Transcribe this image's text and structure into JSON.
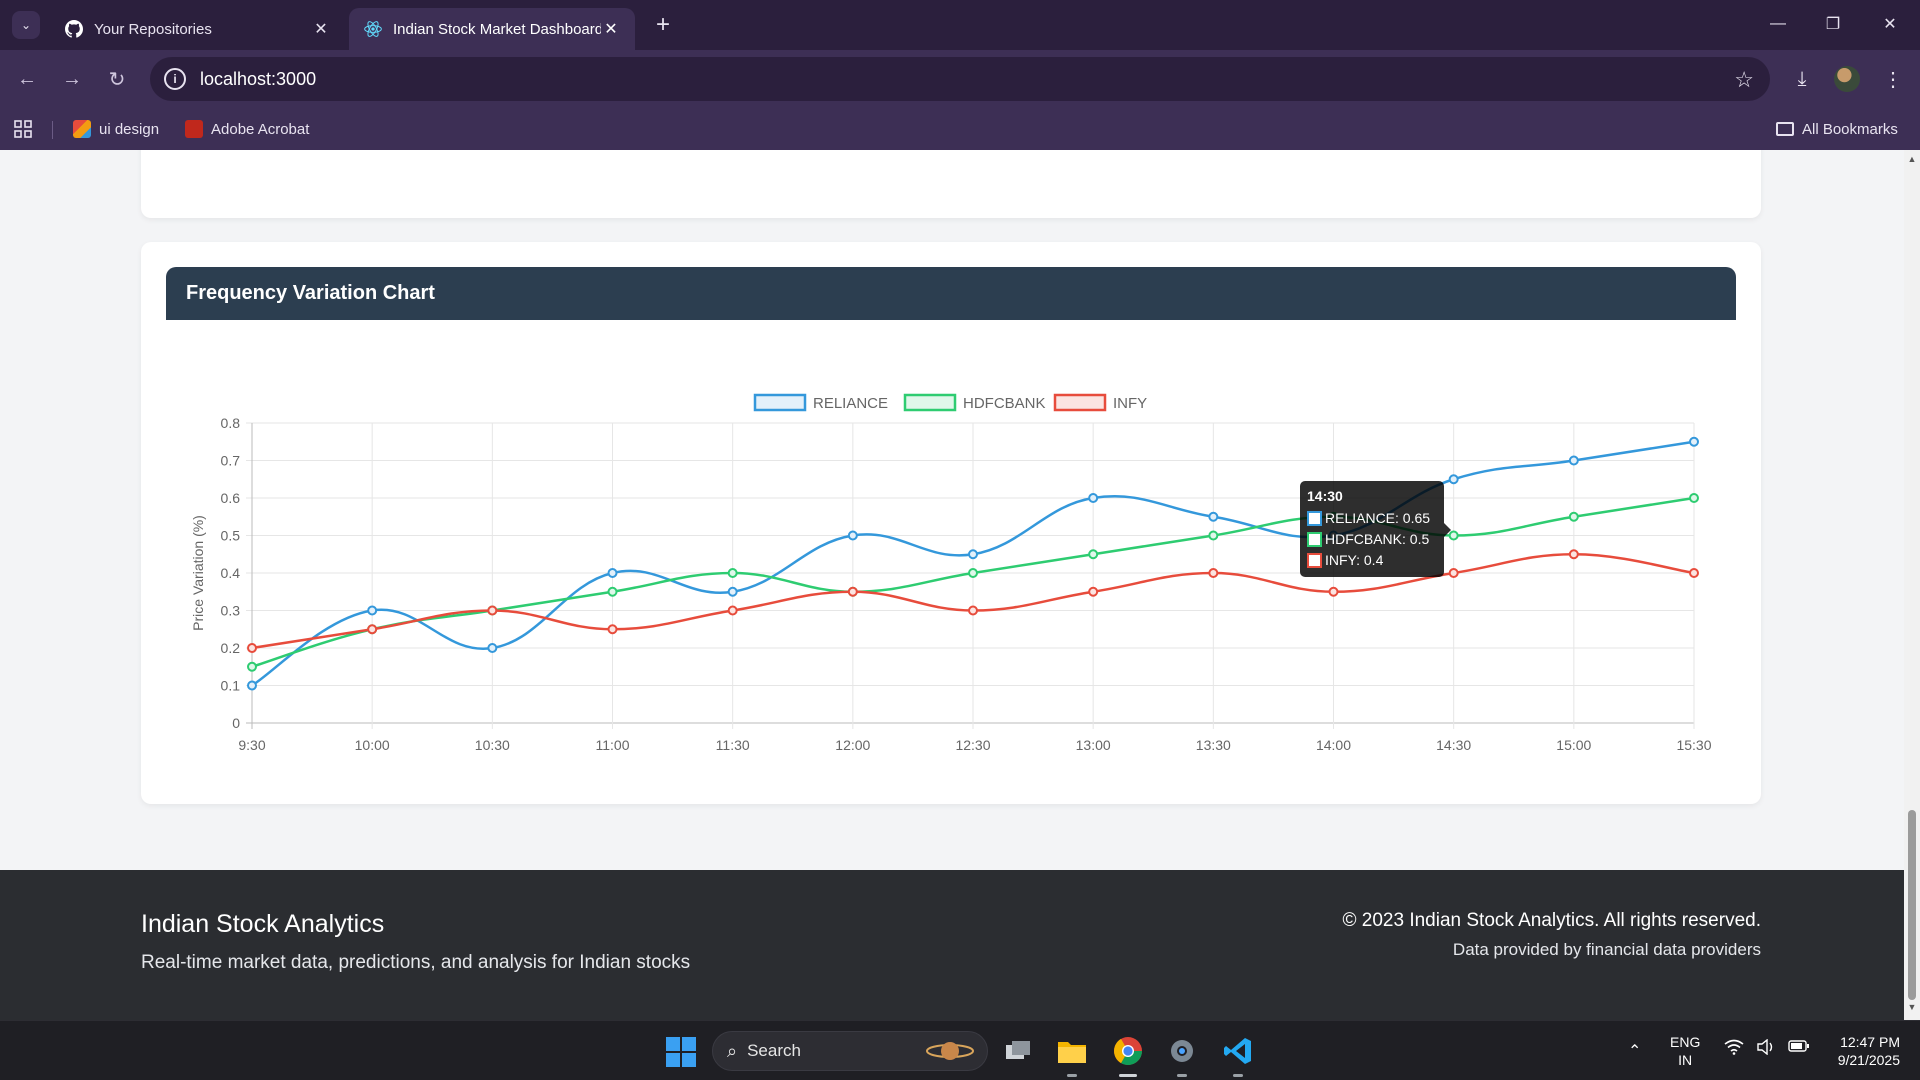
{
  "browser": {
    "tabs": [
      {
        "title": "Your Repositories",
        "icon": "github-icon",
        "active": false
      },
      {
        "title": "Indian Stock Market Dashboard",
        "icon": "react-icon",
        "active": true
      }
    ],
    "url": "localhost:3000",
    "bookmarks": [
      {
        "label": "ui design",
        "icon": "image-bookmark-icon"
      },
      {
        "label": "Adobe Acrobat",
        "icon": "acrobat-icon"
      }
    ],
    "all_bookmarks": "All Bookmarks"
  },
  "chart_card": {
    "title": "Frequency Variation Chart"
  },
  "chart_data": {
    "type": "line",
    "title": "",
    "xlabel": "",
    "ylabel": "Price Variation (%)",
    "ylim": [
      0,
      0.8
    ],
    "yticks": [
      "0",
      "0.1",
      "0.2",
      "0.3",
      "0.4",
      "0.5",
      "0.6",
      "0.7",
      "0.8"
    ],
    "categories": [
      "9:30",
      "10:00",
      "10:30",
      "11:00",
      "11:30",
      "12:00",
      "12:30",
      "13:00",
      "13:30",
      "14:00",
      "14:30",
      "15:00",
      "15:30"
    ],
    "series": [
      {
        "name": "RELIANCE",
        "color": "#3498db",
        "fill": "#e3f0fa",
        "values": [
          0.1,
          0.3,
          0.2,
          0.4,
          0.35,
          0.5,
          0.45,
          0.6,
          0.55,
          0.5,
          0.65,
          0.7,
          0.75
        ]
      },
      {
        "name": "HDFCBANK",
        "color": "#2ecc71",
        "fill": "#e0f7ea",
        "values": [
          0.15,
          0.25,
          0.3,
          0.35,
          0.4,
          0.35,
          0.4,
          0.45,
          0.5,
          0.55,
          0.5,
          0.55,
          0.6
        ]
      },
      {
        "name": "INFY",
        "color": "#e74c3c",
        "fill": "#fbe4e1",
        "values": [
          0.2,
          0.25,
          0.3,
          0.25,
          0.3,
          0.35,
          0.3,
          0.35,
          0.4,
          0.35,
          0.4,
          0.45,
          0.4
        ]
      }
    ],
    "grid": true,
    "legend": "top-center",
    "tooltip": {
      "title": "14:30",
      "lines": [
        "RELIANCE: 0.65",
        "HDFCBANK: 0.5",
        "INFY: 0.4"
      ]
    }
  },
  "footer": {
    "title": "Indian Stock Analytics",
    "subtitle": "Real-time market data, predictions, and analysis for Indian stocks",
    "copyright": "© 2023 Indian Stock Analytics. All rights reserved.",
    "provider": "Data provided by financial data providers"
  },
  "taskbar": {
    "search_label": "Search",
    "lang": "ENG",
    "region": "IN",
    "time": "12:47 PM",
    "date": "9/21/2025"
  }
}
